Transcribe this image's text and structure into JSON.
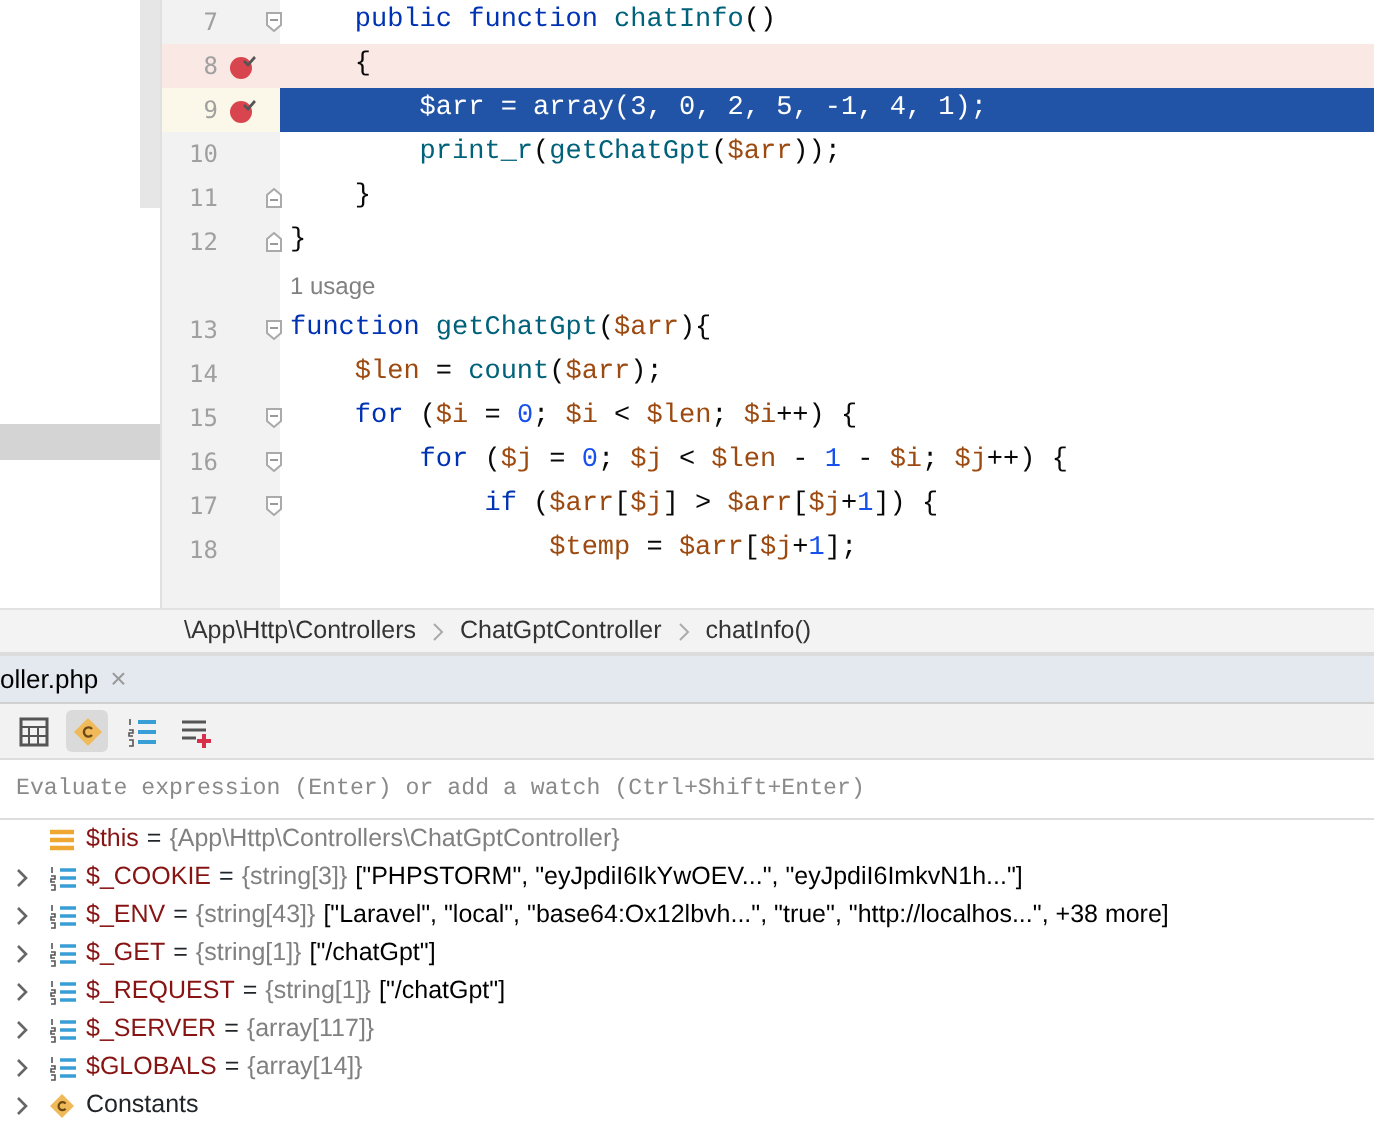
{
  "editor": {
    "lines": [
      {
        "kind": "code",
        "number": "7",
        "fold_start": true,
        "segments": [
          {
            "text": "    public ",
            "kind": "keyword"
          },
          {
            "text": "function ",
            "kind": "keyword"
          },
          {
            "text": "chatInfo",
            "kind": "function"
          },
          {
            "text": "()",
            "kind": "plain"
          }
        ]
      },
      {
        "kind": "code",
        "number": "8",
        "breakpoint": true,
        "segments": [
          {
            "text": "    {",
            "kind": "plain"
          }
        ]
      },
      {
        "kind": "code",
        "number": "9",
        "breakpoint": true,
        "current": true,
        "segments": [
          {
            "text": "        $arr",
            "kind": "variable"
          },
          {
            "text": " = array(",
            "kind": "plain"
          },
          {
            "text": "3",
            "kind": "number"
          },
          {
            "text": ", ",
            "kind": "plain"
          },
          {
            "text": "0",
            "kind": "number"
          },
          {
            "text": ", ",
            "kind": "plain"
          },
          {
            "text": "2",
            "kind": "number"
          },
          {
            "text": ", ",
            "kind": "plain"
          },
          {
            "text": "5",
            "kind": "number"
          },
          {
            "text": ", -",
            "kind": "plain"
          },
          {
            "text": "1",
            "kind": "number"
          },
          {
            "text": ", ",
            "kind": "plain"
          },
          {
            "text": "4",
            "kind": "number"
          },
          {
            "text": ", ",
            "kind": "plain"
          },
          {
            "text": "1",
            "kind": "number"
          },
          {
            "text": ");",
            "kind": "plain"
          }
        ]
      },
      {
        "kind": "code",
        "number": "10",
        "segments": [
          {
            "text": "        print_r",
            "kind": "function"
          },
          {
            "text": "(",
            "kind": "plain"
          },
          {
            "text": "getChatGpt",
            "kind": "function"
          },
          {
            "text": "(",
            "kind": "plain"
          },
          {
            "text": "$arr",
            "kind": "variable"
          },
          {
            "text": "));",
            "kind": "plain"
          }
        ]
      },
      {
        "kind": "code",
        "number": "11",
        "fold_end": true,
        "segments": [
          {
            "text": "    }",
            "kind": "plain"
          }
        ]
      },
      {
        "kind": "code",
        "number": "12",
        "fold_end": true,
        "segments": [
          {
            "text": "}",
            "kind": "plain"
          }
        ]
      },
      {
        "kind": "hint",
        "text": "1 usage"
      },
      {
        "kind": "code",
        "number": "13",
        "fold_start": true,
        "segments": [
          {
            "text": "function ",
            "kind": "keyword"
          },
          {
            "text": "getChatGpt",
            "kind": "function"
          },
          {
            "text": "(",
            "kind": "plain"
          },
          {
            "text": "$arr",
            "kind": "variable"
          },
          {
            "text": "){",
            "kind": "plain"
          }
        ]
      },
      {
        "kind": "code",
        "number": "14",
        "segments": [
          {
            "text": "    $len",
            "kind": "variable"
          },
          {
            "text": " = ",
            "kind": "plain"
          },
          {
            "text": "count",
            "kind": "function"
          },
          {
            "text": "(",
            "kind": "plain"
          },
          {
            "text": "$arr",
            "kind": "variable"
          },
          {
            "text": ");",
            "kind": "plain"
          }
        ]
      },
      {
        "kind": "code",
        "number": "15",
        "fold_start": true,
        "segments": [
          {
            "text": "    for",
            "kind": "keyword"
          },
          {
            "text": " (",
            "kind": "plain"
          },
          {
            "text": "$i",
            "kind": "variable"
          },
          {
            "text": " = ",
            "kind": "plain"
          },
          {
            "text": "0",
            "kind": "number"
          },
          {
            "text": "; ",
            "kind": "plain"
          },
          {
            "text": "$i",
            "kind": "variable"
          },
          {
            "text": " < ",
            "kind": "plain"
          },
          {
            "text": "$len",
            "kind": "variable"
          },
          {
            "text": "; ",
            "kind": "plain"
          },
          {
            "text": "$i",
            "kind": "variable"
          },
          {
            "text": "++) {",
            "kind": "plain"
          }
        ]
      },
      {
        "kind": "code",
        "number": "16",
        "fold_start": true,
        "segments": [
          {
            "text": "        for",
            "kind": "keyword"
          },
          {
            "text": " (",
            "kind": "plain"
          },
          {
            "text": "$j",
            "kind": "variable"
          },
          {
            "text": " = ",
            "kind": "plain"
          },
          {
            "text": "0",
            "kind": "number"
          },
          {
            "text": "; ",
            "kind": "plain"
          },
          {
            "text": "$j",
            "kind": "variable"
          },
          {
            "text": " < ",
            "kind": "plain"
          },
          {
            "text": "$len",
            "kind": "variable"
          },
          {
            "text": " - ",
            "kind": "plain"
          },
          {
            "text": "1",
            "kind": "number"
          },
          {
            "text": " - ",
            "kind": "plain"
          },
          {
            "text": "$i",
            "kind": "variable"
          },
          {
            "text": "; ",
            "kind": "plain"
          },
          {
            "text": "$j",
            "kind": "variable"
          },
          {
            "text": "++) {",
            "kind": "plain"
          }
        ]
      },
      {
        "kind": "code",
        "number": "17",
        "fold_start": true,
        "segments": [
          {
            "text": "            if",
            "kind": "keyword"
          },
          {
            "text": " (",
            "kind": "plain"
          },
          {
            "text": "$arr",
            "kind": "variable"
          },
          {
            "text": "[",
            "kind": "plain"
          },
          {
            "text": "$j",
            "kind": "variable"
          },
          {
            "text": "] > ",
            "kind": "plain"
          },
          {
            "text": "$arr",
            "kind": "variable"
          },
          {
            "text": "[",
            "kind": "plain"
          },
          {
            "text": "$j",
            "kind": "variable"
          },
          {
            "text": "+",
            "kind": "plain"
          },
          {
            "text": "1",
            "kind": "number"
          },
          {
            "text": "]) {",
            "kind": "plain"
          }
        ]
      },
      {
        "kind": "code",
        "number": "18",
        "segments": [
          {
            "text": "                $temp",
            "kind": "variable"
          },
          {
            "text": " = ",
            "kind": "plain"
          },
          {
            "text": "$arr",
            "kind": "variable"
          },
          {
            "text": "[",
            "kind": "plain"
          },
          {
            "text": "$j",
            "kind": "variable"
          },
          {
            "text": "+",
            "kind": "plain"
          },
          {
            "text": "1",
            "kind": "number"
          },
          {
            "text": "];",
            "kind": "plain"
          }
        ]
      }
    ]
  },
  "breadcrumbs": [
    "\\App\\Http\\Controllers",
    "ChatGptController",
    "chatInfo()"
  ],
  "file_tab": {
    "label": "oller.php",
    "close": "×"
  },
  "toolbar": [
    {
      "kind": "calculator",
      "selected": false
    },
    {
      "kind": "constants",
      "selected": true
    },
    {
      "kind": "list",
      "selected": false
    },
    {
      "kind": "add-watch",
      "selected": false
    }
  ],
  "evaluate": {
    "placeholder": "Evaluate expression (Enter) or add a watch (Ctrl+Shift+Enter)"
  },
  "variables": [
    {
      "kind": "object",
      "expandable": false,
      "name": "$this",
      "equals": "=",
      "type": "{App\\Http\\Controllers\\ChatGptController}"
    },
    {
      "kind": "array",
      "expandable": true,
      "name": "$_COOKIE",
      "equals": "=",
      "type": "{string[3]}",
      "value": "[\"PHPSTORM\", \"eyJpdiI6IkYwOEV...\", \"eyJpdiI6ImkvN1h...\"]"
    },
    {
      "kind": "array",
      "expandable": true,
      "name": "$_ENV",
      "equals": "=",
      "type": "{string[43]}",
      "value": "[\"Laravel\", \"local\", \"base64:Ox12lbvh...\", \"true\", \"http://localhos...\", +38 more]"
    },
    {
      "kind": "array",
      "expandable": true,
      "name": "$_GET",
      "equals": "=",
      "type": "{string[1]}",
      "value": "[\"/chatGpt\"]"
    },
    {
      "kind": "array",
      "expandable": true,
      "name": "$_REQUEST",
      "equals": "=",
      "type": "{string[1]}",
      "value": "[\"/chatGpt\"]"
    },
    {
      "kind": "array",
      "expandable": true,
      "name": "$_SERVER",
      "equals": "=",
      "type": "{array[117]}"
    },
    {
      "kind": "array",
      "expandable": true,
      "name": "$GLOBALS",
      "equals": "=",
      "type": "{array[14]}"
    },
    {
      "kind": "constants",
      "expandable": true,
      "name": "Constants"
    }
  ]
}
